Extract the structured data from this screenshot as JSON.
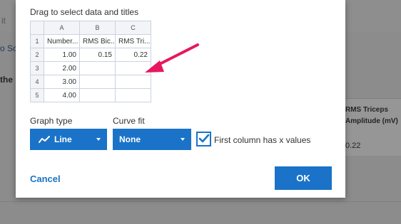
{
  "background": {
    "left_text_1": "it",
    "left_text_2": "o Sc",
    "left_text_3": "the",
    "table_header": "RMS Triceps Amplitude (mV)",
    "table_value": "0.22"
  },
  "dialog": {
    "title": "Drag to select data and titles",
    "sheet": {
      "columns": [
        "A",
        "B",
        "C"
      ],
      "rows": [
        {
          "num": "1",
          "cells": [
            "Number...",
            "RMS Bic...",
            "RMS Tri..."
          ]
        },
        {
          "num": "2",
          "cells": [
            "1.00",
            "0.15",
            "0.22"
          ]
        },
        {
          "num": "3",
          "cells": [
            "2.00",
            "",
            ""
          ]
        },
        {
          "num": "4",
          "cells": [
            "3.00",
            "",
            ""
          ]
        },
        {
          "num": "5",
          "cells": [
            "4.00",
            "",
            ""
          ]
        }
      ]
    },
    "graph_type_label": "Graph type",
    "graph_type_value": "Line",
    "curve_fit_label": "Curve fit",
    "curve_fit_value": "None",
    "first_column_x": "First column has x values",
    "first_column_x_checked": true,
    "cancel_label": "Cancel",
    "ok_label": "OK"
  },
  "colors": {
    "accent": "#1a73c8",
    "annotation_arrow": "#e8175d"
  }
}
